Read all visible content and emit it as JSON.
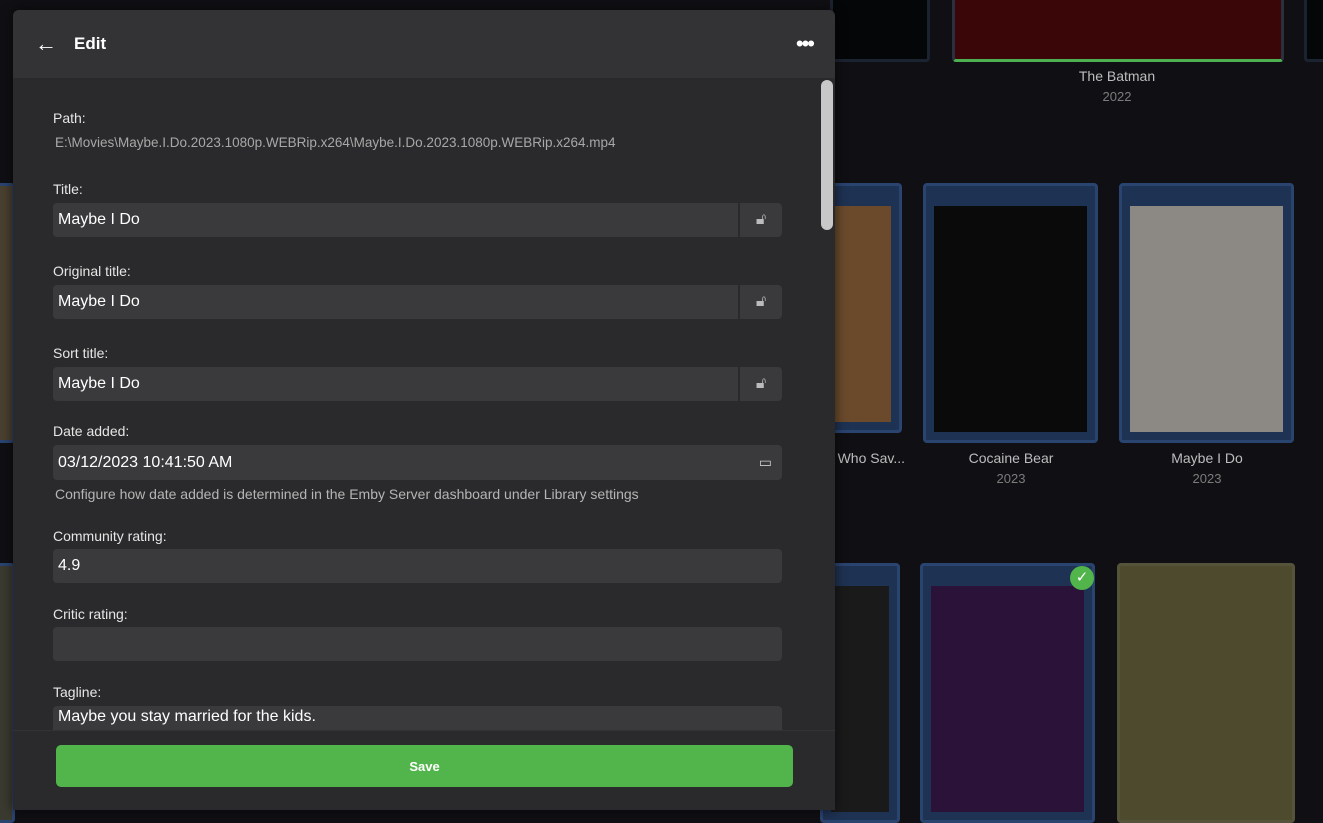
{
  "dialog": {
    "title": "Edit",
    "back_icon": "arrow-left-icon",
    "more_icon": "more-horizontal-icon",
    "path_label": "Path:",
    "path_value": "E:\\Movies\\Maybe.I.Do.2023.1080p.WEBRip.x264\\Maybe.I.Do.2023.1080p.WEBRip.x264.mp4",
    "fields": [
      {
        "label": "Title:",
        "value": "Maybe I Do",
        "locked": false
      },
      {
        "label": "Original title:",
        "value": "Maybe I Do",
        "locked": false
      },
      {
        "label": "Sort title:",
        "value": "Maybe I Do",
        "locked": false
      }
    ],
    "date_added": {
      "label": "Date added:",
      "value": "03/12/2023 10:41:50 AM",
      "help": "Configure how date added is determined in the Emby Server dashboard under Library settings"
    },
    "community_rating": {
      "label": "Community rating:",
      "value": "4.9"
    },
    "critic_rating": {
      "label": "Critic rating:",
      "value": ""
    },
    "tagline": {
      "label": "Tagline:",
      "value": "Maybe you stay married for the kids."
    },
    "save_label": "Save",
    "accent": "#52b54b"
  },
  "library": {
    "items": [
      {
        "title": "The Batman",
        "year": "2022"
      },
      {
        "title": "Who Sav...",
        "year": ""
      },
      {
        "title": "Cocaine Bear",
        "year": "2023"
      },
      {
        "title": "Maybe I Do",
        "year": "2023"
      }
    ]
  }
}
